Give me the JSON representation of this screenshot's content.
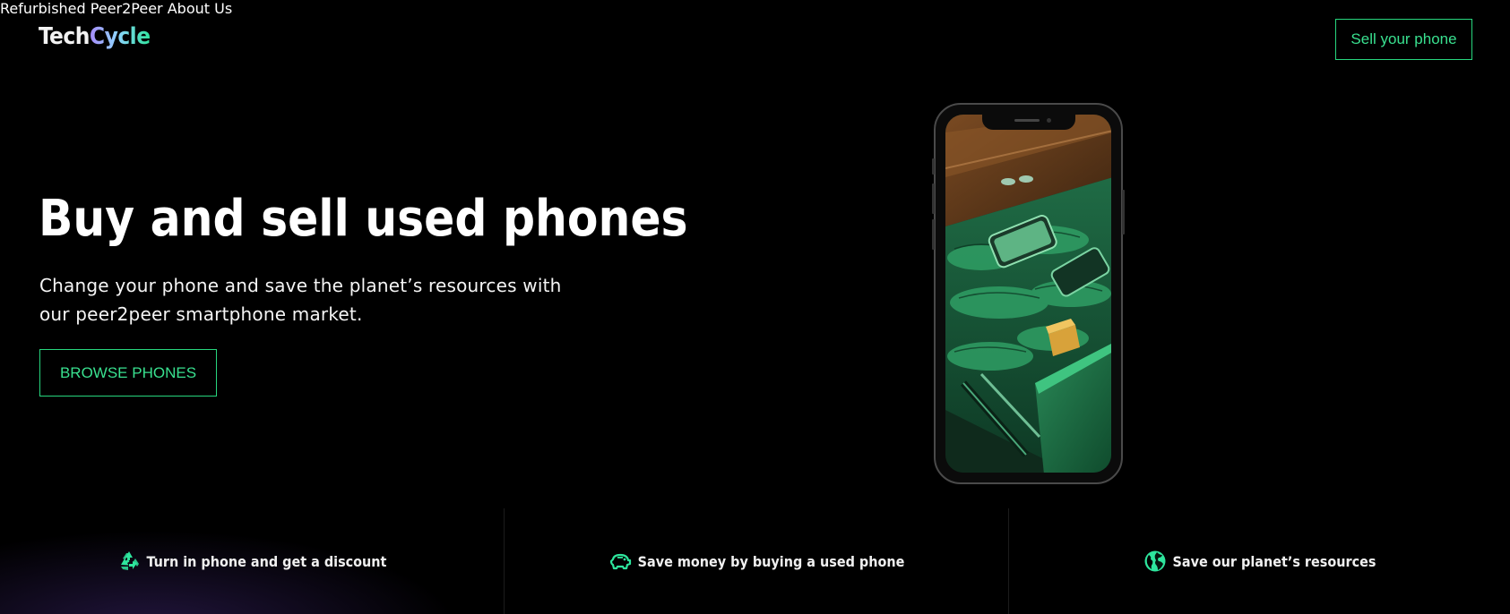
{
  "header": {
    "logo_part1": "Tech",
    "logo_part2": "Cycle",
    "nav": [
      "Refurbished",
      "Peer2Peer",
      "About Us"
    ],
    "cta_label": "Sell your phone"
  },
  "hero": {
    "title": "Buy and sell used phones",
    "subtitle_line1": "Change your phone and save the planet’s resources with",
    "subtitle_line2": "our peer2peer smartphone market.",
    "button_label": "BROWSE PHONES"
  },
  "features": [
    {
      "icon": "recycle-icon",
      "label": "Turn in phone and get a discount"
    },
    {
      "icon": "piggy-bank-icon",
      "label": "Save money by buying a used phone"
    },
    {
      "icon": "globe-icon",
      "label": "Save our planet’s resources"
    }
  ],
  "colors": {
    "accent": "#27d67e",
    "background": "#000000",
    "nav_text": "#a3a3a3"
  }
}
